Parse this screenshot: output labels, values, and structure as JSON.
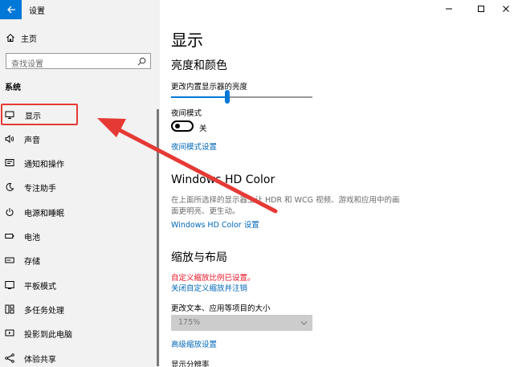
{
  "window": {
    "title": "设置",
    "colors": {
      "accent": "#0078d7",
      "sidebar_bg": "#f2f2f2",
      "link": "#0067b8",
      "warning": "#e81123",
      "annotation": "#e53935"
    }
  },
  "sidebar": {
    "home_label": "主页",
    "search_placeholder": "查找设置",
    "section_label": "系统",
    "items": [
      {
        "label": "显示",
        "icon": "monitor-icon",
        "active": true
      },
      {
        "label": "声音",
        "icon": "speaker-icon"
      },
      {
        "label": "通知和操作",
        "icon": "notification-icon"
      },
      {
        "label": "专注助手",
        "icon": "moon-icon"
      },
      {
        "label": "电源和睡眠",
        "icon": "power-icon"
      },
      {
        "label": "电池",
        "icon": "battery-icon"
      },
      {
        "label": "存储",
        "icon": "storage-icon"
      },
      {
        "label": "平板模式",
        "icon": "tablet-icon"
      },
      {
        "label": "多任务处理",
        "icon": "multitask-icon"
      },
      {
        "label": "投影到此电脑",
        "icon": "projector-icon"
      },
      {
        "label": "体验共享",
        "icon": "share-icon"
      }
    ]
  },
  "main": {
    "page_title": "显示",
    "brightness_section": {
      "heading": "亮度和颜色",
      "slider_label": "更改内置显示器的亮度",
      "brightness_fraction": 0.4,
      "night_light_label": "夜间模式",
      "night_light_state": "关",
      "night_light_link": "夜间模式设置"
    },
    "hdr_section": {
      "heading": "Windows HD Color",
      "description": "在上面所选择的显示器上让 HDR 和 WCG 视频、游戏和应用中的画面更明亮、更生动。",
      "link": "Windows HD Color 设置"
    },
    "scale_section": {
      "heading": "缩放与布局",
      "custom_scale_warning": "自定义缩放比例已设置。",
      "turn_off_link": "关闭自定义缩放并注销",
      "size_label": "更改文本、应用等项目的大小",
      "size_value": "175%",
      "advanced_link": "高级缩放设置",
      "resolution_label": "显示分辨率"
    }
  }
}
